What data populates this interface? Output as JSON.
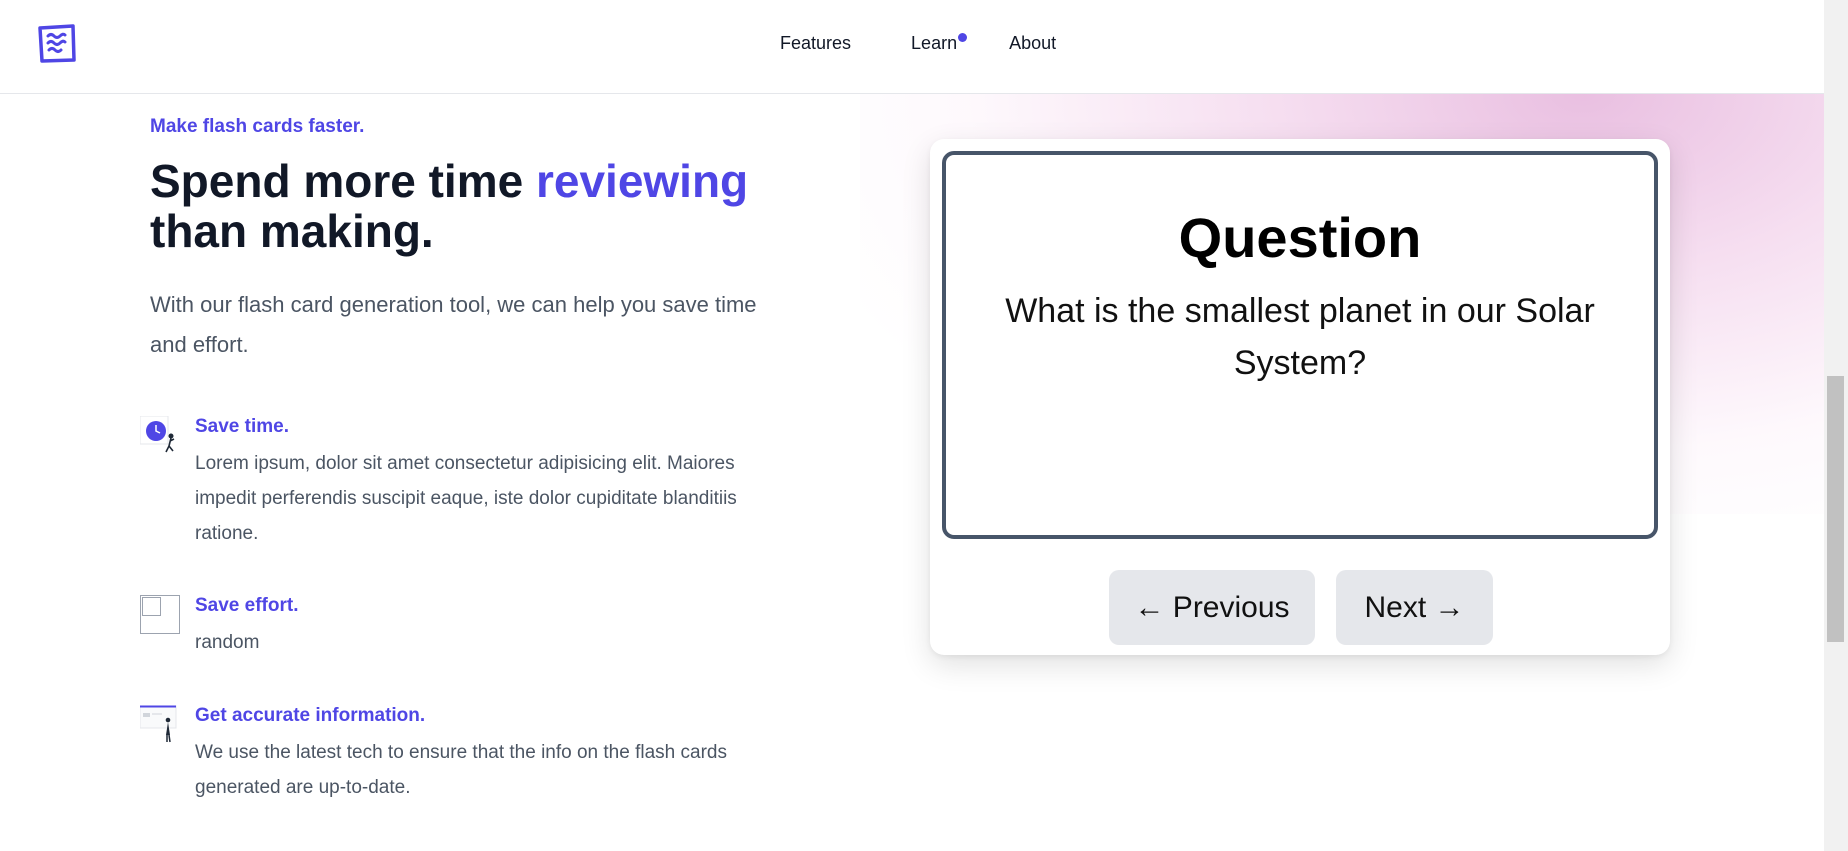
{
  "nav": {
    "logo_icon": "wave-square-logo-icon",
    "links": [
      {
        "label": "Features"
      },
      {
        "label": "Learn"
      },
      {
        "label": "About"
      }
    ]
  },
  "hero": {
    "eyebrow": "Make flash cards faster.",
    "headline_part1": "Spend more time ",
    "headline_accent": "reviewing",
    "headline_part2": "than making.",
    "subtext": "With our flash card generation tool, we can help you save time and effort."
  },
  "features": [
    {
      "icon": "clock-person-illustration-icon",
      "title": "Save time.",
      "desc": "Lorem ipsum, dolor sit amet consectetur adipisicing elit. Maiores impedit perferendis suscipit eaque, iste dolor cupiditate blanditiis ratione."
    },
    {
      "icon": "broken-image-icon",
      "title": "Save effort.",
      "desc": "random"
    },
    {
      "icon": "person-board-illustration-icon",
      "title": "Get accurate information.",
      "desc": "We use the latest tech to ensure that the info on the flash cards generated are up-to-date."
    }
  ],
  "flashcard": {
    "heading": "Question",
    "text": "What is the smallest planet in our Solar System?",
    "prev_label": "← Previous",
    "next_label": "Next →"
  },
  "colors": {
    "accent": "#4f46e5",
    "card_border": "#475569",
    "button_bg": "#e5e7eb"
  }
}
